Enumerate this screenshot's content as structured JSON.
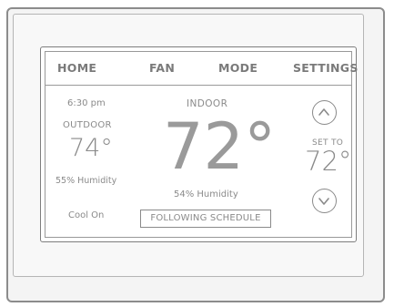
{
  "nav": {
    "home": "HOME",
    "fan": "FAN",
    "mode": "MODE",
    "settings": "SETTINGS"
  },
  "status": {
    "time": "6:30 pm",
    "outdoor_label": "OUTDOOR",
    "outdoor_temp": "74°",
    "outdoor_humidity": "55% Humidity",
    "system_mode": "Cool On"
  },
  "indoor": {
    "label": "INDOOR",
    "temp": "72°",
    "humidity": "54% Humidity",
    "schedule_button": "FOLLOWING SCHEDULE"
  },
  "setpoint": {
    "label": "SET TO",
    "value": "72°"
  },
  "icons": {
    "up": "chevron-up-icon",
    "down": "chevron-down-icon"
  },
  "colors": {
    "text": "#8a8a8a",
    "border": "#8c8c8c"
  }
}
